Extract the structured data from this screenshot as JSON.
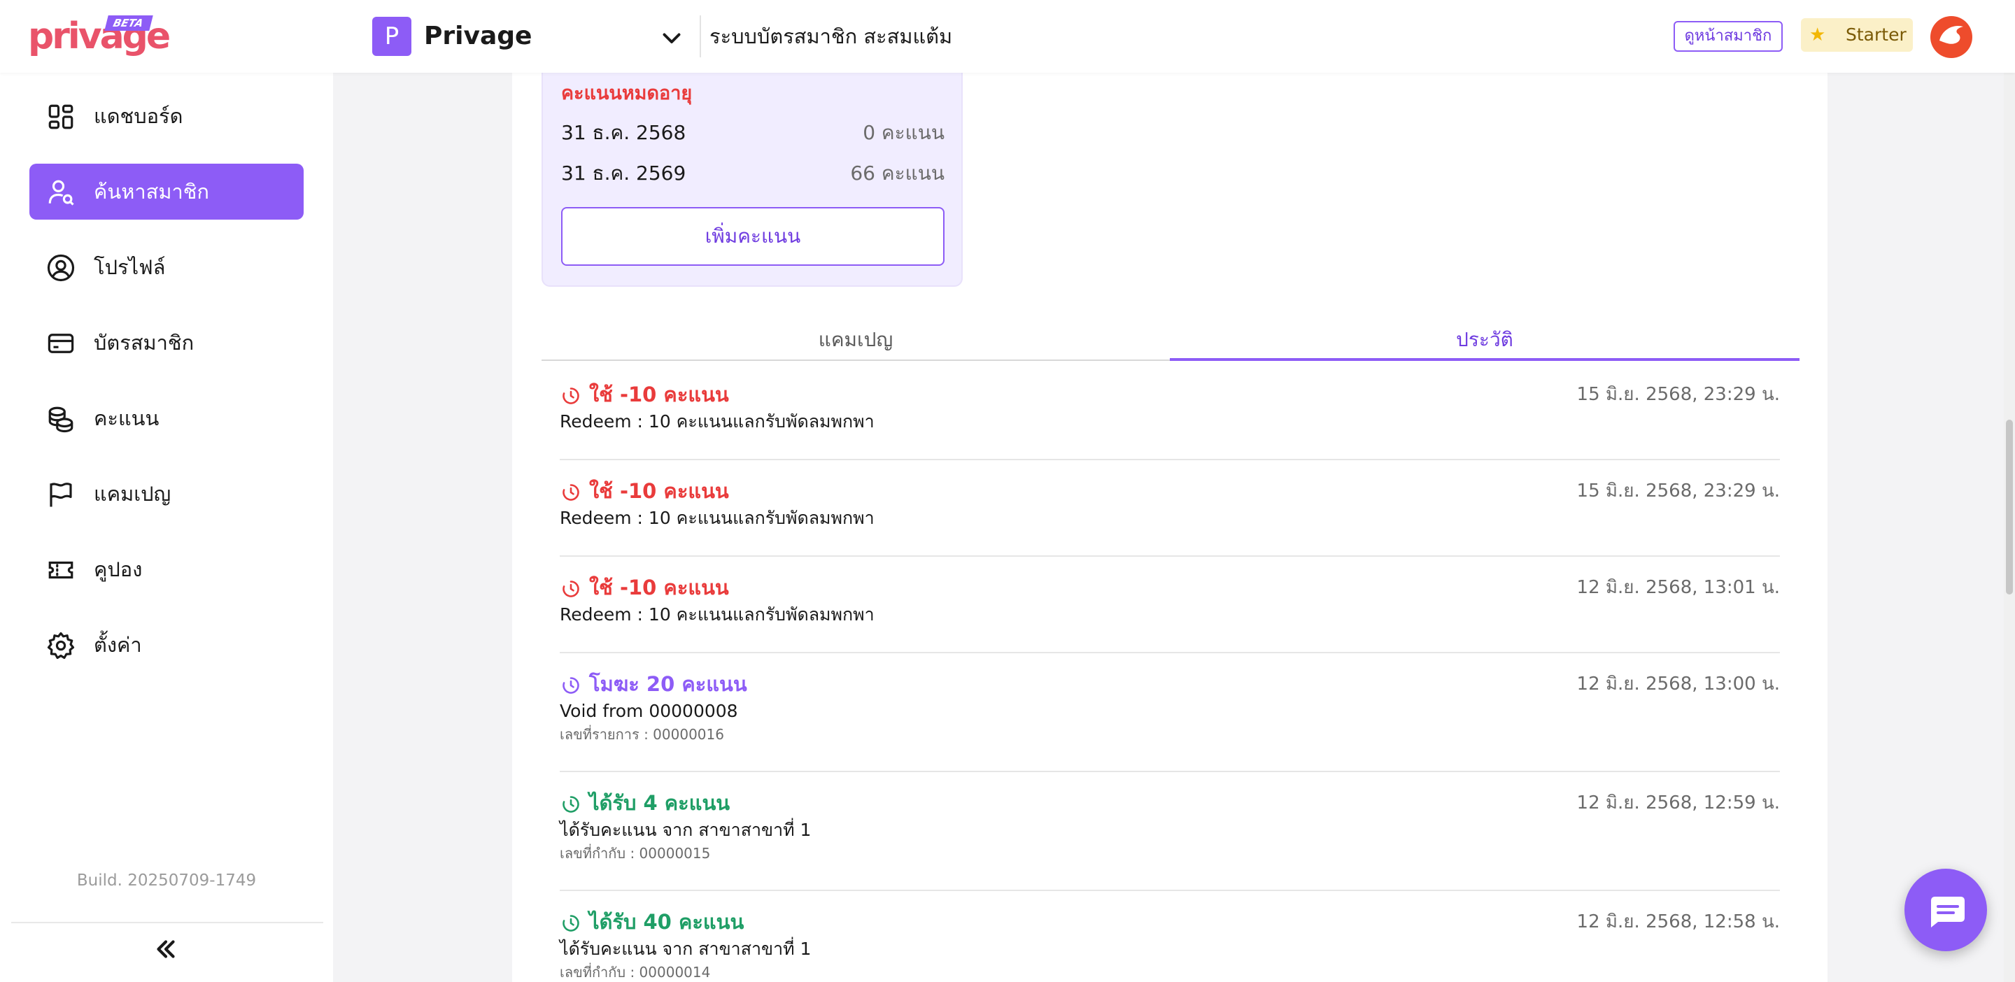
{
  "app": {
    "logo_text": "privage",
    "logo_beta": "BETA",
    "workspace_initial": "P",
    "workspace_name": "Privage",
    "system_title": "ระบบบัตรสมาชิก สะสมแต้ม",
    "member_page_label": "ดูหน้าสมาชิก",
    "plan_label": "Starter"
  },
  "sidebar": {
    "items": [
      {
        "label": "แดชบอร์ด",
        "icon": "dashboard-icon",
        "active": false
      },
      {
        "label": "ค้นหาสมาชิก",
        "icon": "user-search-icon",
        "active": true
      },
      {
        "label": "โปรไฟล์",
        "icon": "profile-icon",
        "active": false
      },
      {
        "label": "บัตรสมาชิก",
        "icon": "card-icon",
        "active": false
      },
      {
        "label": "คะแนน",
        "icon": "coins-icon",
        "active": false
      },
      {
        "label": "แคมเปญ",
        "icon": "flag-icon",
        "active": false
      },
      {
        "label": "คูปอง",
        "icon": "ticket-icon",
        "active": false
      },
      {
        "label": "ตั้งค่า",
        "icon": "gear-icon",
        "active": false
      }
    ],
    "build": "Build. 20250709-1749"
  },
  "points_card": {
    "expiring_title": "คะแนนหมดอายุ",
    "rows": [
      {
        "date": "31 ธ.ค. 2568",
        "points": "0 คะแนน"
      },
      {
        "date": "31 ธ.ค. 2569",
        "points": "66 คะแนน"
      }
    ],
    "add_button": "เพิ่มคะแนน"
  },
  "tabs": {
    "campaign": "แคมเปญ",
    "history": "ประวัติ",
    "active": "history"
  },
  "history": [
    {
      "type": "use",
      "title": "ใช้ -10 คะแนน",
      "time": "15 มิ.ย. 2568, 23:29 น.",
      "desc": "Redeem : 10 คะแนนแลกรับพัดลมพกพา"
    },
    {
      "type": "use",
      "title": "ใช้ -10 คะแนน",
      "time": "15 มิ.ย. 2568, 23:29 น.",
      "desc": "Redeem : 10 คะแนนแลกรับพัดลมพกพา"
    },
    {
      "type": "use",
      "title": "ใช้ -10 คะแนน",
      "time": "12 มิ.ย. 2568, 13:01 น.",
      "desc": "Redeem : 10 คะแนนแลกรับพัดลมพกพา"
    },
    {
      "type": "void",
      "title": "โมฆะ 20 คะแนน",
      "time": "12 มิ.ย. 2568, 13:00 น.",
      "desc": "Void from 00000008",
      "ref": "เลขที่รายการ : 00000016"
    },
    {
      "type": "earn",
      "title": "ได้รับ 4 คะแนน",
      "time": "12 มิ.ย. 2568, 12:59 น.",
      "desc": "ได้รับคะแนน จาก สาขาสาขาที่ 1",
      "ref": "เลขที่กำกับ : 00000015"
    },
    {
      "type": "earn",
      "title": "ได้รับ 40 คะแนน",
      "time": "12 มิ.ย. 2568, 12:58 น.",
      "desc": "ได้รับคะแนน จาก สาขาสาขาที่ 1",
      "ref": "เลขที่กำกับ : 00000014"
    }
  ],
  "colors": {
    "accent": "#8d5cf6",
    "use": "#e93b3b",
    "void": "#8d5cf6",
    "earn": "#1f9e66"
  }
}
